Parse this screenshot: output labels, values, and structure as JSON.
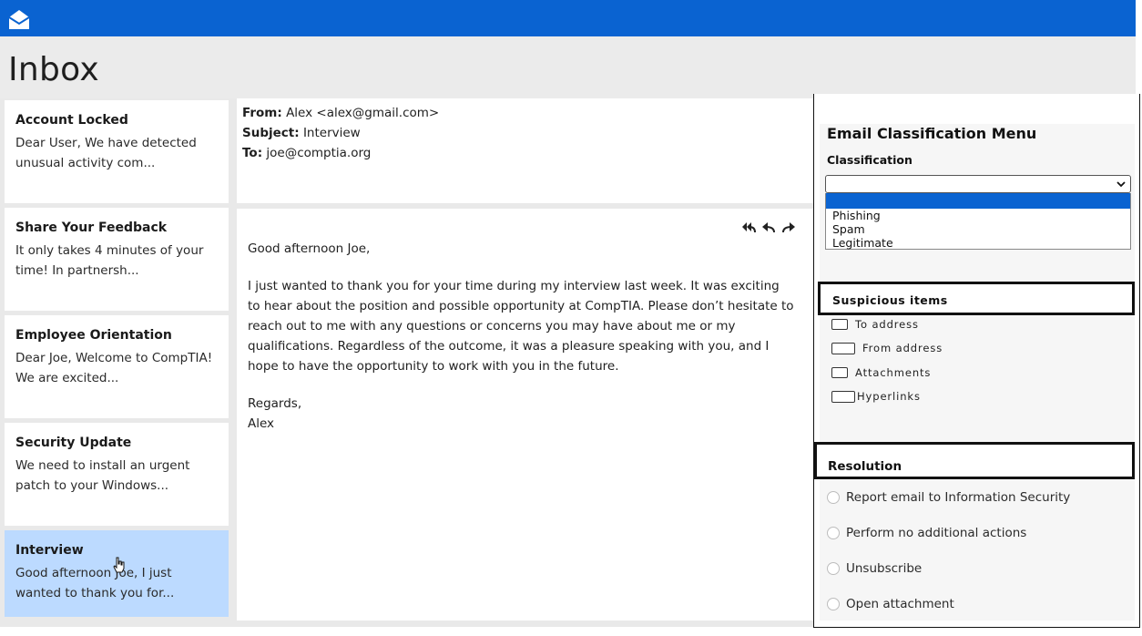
{
  "app": {
    "title": "Inbox",
    "logo_icon": "envelope-open-icon",
    "brand_color": "#0a63d1"
  },
  "messages": [
    {
      "title": "Account Locked",
      "preview": "Dear User, We have detected unusual activity com..."
    },
    {
      "title": "Share Your Feedback",
      "preview": "It only takes 4 minutes of your time! In partnersh..."
    },
    {
      "title": "Employee Orientation",
      "preview": "Dear Joe, Welcome to CompTIA! We are excited..."
    },
    {
      "title": "Security Update",
      "preview": "We need to install an urgent patch to your Windows..."
    },
    {
      "title": "Interview",
      "preview": "Good afternoon Joe, I just wanted to thank you for...",
      "selected": true
    }
  ],
  "email": {
    "from_label": "From:",
    "from": "Alex <alex@gmail.com>",
    "subject_label": "Subject:",
    "subject": "Interview",
    "to_label": "To:",
    "to": "joe@comptia.org",
    "action_icons": [
      "reply-all-icon",
      "reply-icon",
      "forward-icon"
    ],
    "greeting": "Good afternoon Joe,",
    "body": "I just wanted to thank you for your time during my interview last week. It was exciting to hear about the position and possible opportunity at CompTIA. Please don’t hesitate to reach out to me with any questions or concerns you may have about me or my qualifications. Regardless of the outcome, it was a pleasure speaking with you, and I hope to have the opportunity to work with you in the future.",
    "signoff": "Regards,",
    "signature": "Alex"
  },
  "classification_menu": {
    "title": "Email Classification Menu",
    "classification_label": "Classification",
    "selected_value": "",
    "options": [
      "Phishing",
      "Spam",
      "Legitimate"
    ],
    "suspicious_title": "Suspicious items",
    "suspicious_items": [
      "To address",
      "From address",
      "Attachments",
      "Hyperlinks"
    ],
    "resolution_title": "Resolution",
    "resolution_options": [
      "Report email to Information Security",
      "Perform no additional actions",
      "Unsubscribe",
      "Open attachment"
    ]
  }
}
